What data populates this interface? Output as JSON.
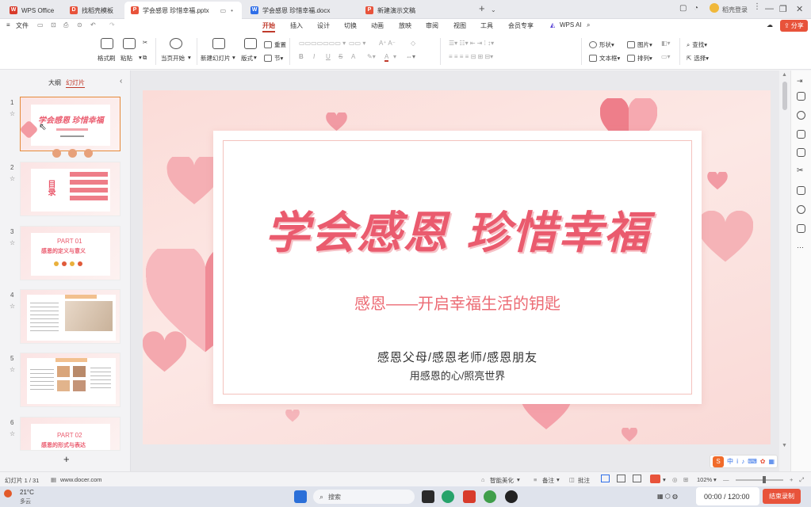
{
  "titlebar": {
    "tabs": [
      {
        "label": "WPS Office",
        "color": "#d83b2b"
      },
      {
        "label": "找稻壳模板",
        "color": "#e8533b"
      },
      {
        "label": "学会感恩 珍惜幸福.pptx",
        "color": "#e8533b",
        "active": true
      },
      {
        "label": "学会感恩 珍惜幸福.docx",
        "color": "#2f6ee8"
      },
      {
        "label": "新建演示文稿",
        "color": "#e8533b"
      }
    ],
    "new_tab": "+",
    "user_label": "稻壳登录",
    "share_label": "分享"
  },
  "menu": {
    "file": "文件",
    "items": [
      "开始",
      "插入",
      "设计",
      "切换",
      "动画",
      "放映",
      "审阅",
      "视图",
      "工具",
      "会员专享",
      "WPS AI"
    ],
    "active": "开始"
  },
  "ribbon": {
    "format_painter": "格式刷",
    "paste": "粘贴",
    "play_from_current": "当页开始",
    "new_slide": "新建幻灯片",
    "layout": "版式",
    "reset": "重置",
    "section": "节",
    "shape": "形状",
    "picture": "图片",
    "textbox": "文本框",
    "arrange": "排列",
    "find": "查找",
    "select": "选择",
    "font_buttons": [
      "B",
      "I",
      "U",
      "S",
      "A",
      "A"
    ]
  },
  "leftpanel": {
    "tab_outline": "大纲",
    "tab_slides": "幻灯片",
    "slides": [
      {
        "num": "1",
        "title": "学会感恩 珍惜幸福"
      },
      {
        "num": "2",
        "title": "目录"
      },
      {
        "num": "3",
        "part": "PART 01",
        "title": "感恩的定义与意义"
      },
      {
        "num": "4"
      },
      {
        "num": "5"
      },
      {
        "num": "6",
        "part": "PART 02",
        "title": "感恩的形式与表达"
      }
    ],
    "add": "+"
  },
  "slide": {
    "title": "学会感恩 珍惜幸福",
    "subtitle": "感恩——开启幸福生活的钥匙",
    "line1": "感恩父母/感恩老师/感恩朋友",
    "line2": "用感恩的心/照亮世界",
    "accent": "#ea5b6e",
    "subtitle_color": "#ec6b74"
  },
  "statusbar": {
    "slide_count": "幻灯片 1 / 31",
    "website": "www.docer.com",
    "beautify": "智能美化",
    "notes": "备注",
    "comments": "批注",
    "zoom": "102%"
  },
  "taskbar": {
    "weather_temp": "21°C",
    "weather_desc": "多云",
    "search": "搜索",
    "timer": "00:00 / 120:00",
    "stop_record": "结束录制"
  }
}
